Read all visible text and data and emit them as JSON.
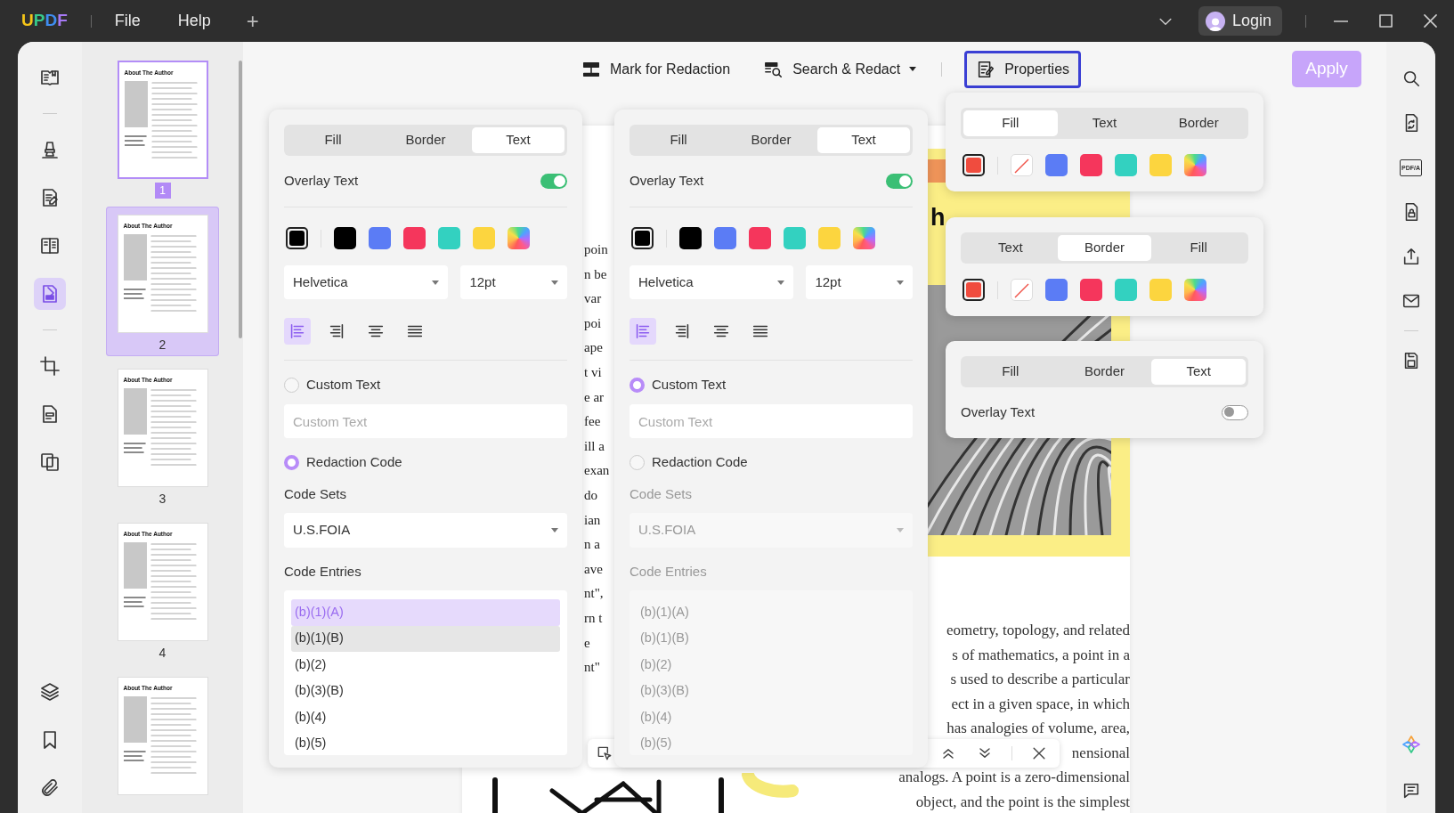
{
  "title_bar": {
    "logo": "UPDF",
    "menus": [
      "File",
      "Help"
    ],
    "new_tab": "+",
    "login": "Login"
  },
  "tool_rail": [
    {
      "selected": false
    },
    {
      "selected": false
    },
    {
      "selected": false
    },
    {
      "selected": false
    },
    {
      "selected": true
    },
    {
      "selected": false
    },
    {
      "selected": false
    },
    {
      "selected": false
    },
    {
      "selected": false
    },
    {
      "selected": false
    },
    {
      "selected": false
    }
  ],
  "thumbnails": [
    {
      "title": "About The Author",
      "page": "1",
      "selected": true,
      "hovered": false
    },
    {
      "title": "About The Author",
      "page": "2",
      "selected": false,
      "hovered": true
    },
    {
      "title": "About The Author",
      "page": "3",
      "selected": false,
      "hovered": false
    },
    {
      "title": "About The Author",
      "page": "4",
      "selected": false,
      "hovered": false
    },
    {
      "title": "About The Author",
      "selected": false,
      "hovered": false
    }
  ],
  "toolbar": {
    "buttons": [
      {
        "label": "Mark for Redaction",
        "dropdown": false,
        "selected": false
      },
      {
        "label": "Search & Redact",
        "dropdown": true,
        "selected": false
      },
      {
        "label": "Properties",
        "dropdown": false,
        "selected": true
      }
    ],
    "apply": {
      "label": "Apply",
      "disabled": true
    }
  },
  "document": {
    "heading": "h",
    "left_fragments": [
      "poin",
      "n be",
      "var",
      "poi",
      "ape",
      "t vi",
      "e ar",
      "fee",
      "ill a",
      "exan",
      "do",
      "ian",
      "n a",
      "ave",
      "nt\",",
      "rn t",
      "e",
      "nt\""
    ],
    "right_lines": [
      "eometry, topology, and related",
      "s of mathematics, a point in a",
      "s used to describe a particular",
      "ect in a given space, in which",
      "has analogies of volume, area,",
      "nensional",
      "analogs. A point is a zero-dimensional",
      "object, and the point is the simplest"
    ]
  },
  "panels": [
    {
      "tabs": [
        {
          "label": "Fill",
          "selected": false
        },
        {
          "label": "Border",
          "selected": false
        },
        {
          "label": "Text",
          "selected": true
        }
      ],
      "overlay_text": {
        "label": "Overlay Text",
        "on": true
      },
      "swatches": [
        {
          "kind": "current",
          "color": "#000000"
        },
        {
          "kind": "solid",
          "color": "#000000"
        },
        {
          "kind": "solid",
          "color": "#5b7cf5"
        },
        {
          "kind": "solid",
          "color": "#f5365c"
        },
        {
          "kind": "solid",
          "color": "#33d1c0"
        },
        {
          "kind": "solid",
          "color": "#fcd53f"
        },
        {
          "kind": "gradient"
        }
      ],
      "font": "Helvetica",
      "font_size": "12pt",
      "alignments": [
        {
          "selected": true
        },
        {
          "selected": false
        },
        {
          "selected": false
        },
        {
          "selected": false
        }
      ],
      "custom_text": {
        "label": "Custom Text",
        "selected": false,
        "placeholder": "Custom Text"
      },
      "redaction_code": {
        "label": "Redaction Code",
        "selected": true
      },
      "code_sets_label": "Code Sets",
      "code_set": "U.S.FOIA",
      "code_entries_label": "Code Entries",
      "code_disabled": false,
      "entries": [
        {
          "label": "(b)(1)(A)",
          "selected": true,
          "hovered": false
        },
        {
          "label": "(b)(1)(B)",
          "selected": false,
          "hovered": true
        },
        {
          "label": "(b)(2)",
          "selected": false,
          "hovered": false
        },
        {
          "label": "(b)(3)(B)",
          "selected": false,
          "hovered": false
        },
        {
          "label": "(b)(4)",
          "selected": false,
          "hovered": false
        },
        {
          "label": "(b)(5)",
          "selected": false,
          "hovered": false
        }
      ]
    },
    {
      "tabs": [
        {
          "label": "Fill",
          "selected": false
        },
        {
          "label": "Border",
          "selected": false
        },
        {
          "label": "Text",
          "selected": true
        }
      ],
      "overlay_text": {
        "label": "Overlay Text",
        "on": true
      },
      "swatches": [
        {
          "kind": "current",
          "color": "#000000"
        },
        {
          "kind": "solid",
          "color": "#000000"
        },
        {
          "kind": "solid",
          "color": "#5b7cf5"
        },
        {
          "kind": "solid",
          "color": "#f5365c"
        },
        {
          "kind": "solid",
          "color": "#33d1c0"
        },
        {
          "kind": "solid",
          "color": "#fcd53f"
        },
        {
          "kind": "gradient"
        }
      ],
      "font": "Helvetica",
      "font_size": "12pt",
      "alignments": [
        {
          "selected": true
        },
        {
          "selected": false
        },
        {
          "selected": false
        },
        {
          "selected": false
        }
      ],
      "custom_text": {
        "label": "Custom Text",
        "selected": true,
        "placeholder": "Custom Text"
      },
      "redaction_code": {
        "label": "Redaction Code",
        "selected": false
      },
      "code_sets_label": "Code Sets",
      "code_set": "U.S.FOIA",
      "code_entries_label": "Code Entries",
      "code_disabled": true,
      "entries": [
        {
          "label": "(b)(1)(A)",
          "selected": false,
          "hovered": false
        },
        {
          "label": "(b)(1)(B)",
          "selected": false,
          "hovered": false
        },
        {
          "label": "(b)(2)",
          "selected": false,
          "hovered": false
        },
        {
          "label": "(b)(3)(B)",
          "selected": false,
          "hovered": false
        },
        {
          "label": "(b)(4)",
          "selected": false,
          "hovered": false
        },
        {
          "label": "(b)(5)",
          "selected": false,
          "hovered": false
        }
      ]
    }
  ],
  "mini_panels": [
    {
      "tabs": [
        {
          "label": "Fill",
          "selected": true
        },
        {
          "label": "Text",
          "selected": false
        },
        {
          "label": "Border",
          "selected": false
        }
      ],
      "swatches": [
        {
          "kind": "current",
          "color": "#f04c3e"
        },
        {
          "kind": "none"
        },
        {
          "kind": "solid",
          "color": "#5b7cf5"
        },
        {
          "kind": "solid",
          "color": "#f5365c"
        },
        {
          "kind": "solid",
          "color": "#33d1c0"
        },
        {
          "kind": "solid",
          "color": "#fcd53f"
        },
        {
          "kind": "gradient"
        }
      ]
    },
    {
      "tabs": [
        {
          "label": "Text",
          "selected": false
        },
        {
          "label": "Border",
          "selected": true
        },
        {
          "label": "Fill",
          "selected": false
        }
      ],
      "swatches": [
        {
          "kind": "current",
          "color": "#f04c3e"
        },
        {
          "kind": "none"
        },
        {
          "kind": "solid",
          "color": "#5b7cf5"
        },
        {
          "kind": "solid",
          "color": "#f5365c"
        },
        {
          "kind": "solid",
          "color": "#33d1c0"
        },
        {
          "kind": "solid",
          "color": "#fcd53f"
        },
        {
          "kind": "gradient"
        }
      ]
    },
    {
      "tabs": [
        {
          "label": "Fill",
          "selected": false
        },
        {
          "label": "Border",
          "selected": false
        },
        {
          "label": "Text",
          "selected": true
        }
      ],
      "overlay_text": {
        "label": "Overlay Text",
        "on": false
      }
    }
  ],
  "right_rail": {
    "pdfa_label": "PDF/A"
  }
}
